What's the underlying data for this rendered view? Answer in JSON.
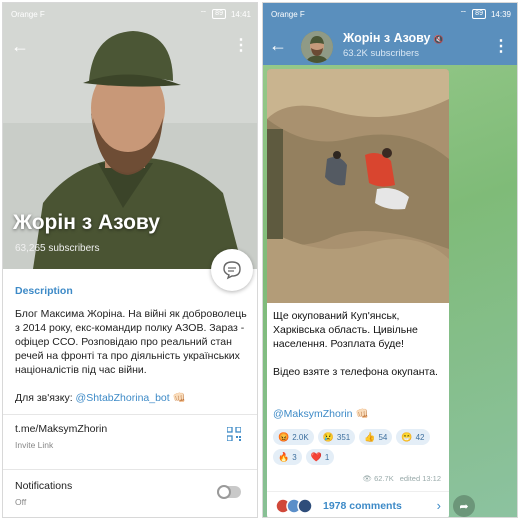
{
  "left_status": {
    "carrier": "Orange F",
    "time": "14:41",
    "battery": "89"
  },
  "right_status": {
    "carrier": "Orange F",
    "time": "14:39",
    "battery": "89"
  },
  "profile": {
    "title": "Жорін з Азову",
    "subscribers": "63,265 subscribers",
    "description_heading": "Description",
    "description": "Блог Максима Жоріна. На війні як доброволець з 2014 року, екс-командир полку АЗОВ. Зараз - офіцер ССО. Розповідаю про реальний стан речей на фронті та про діяльність українських націоналістів під час війни.",
    "contact_label": "Для зв'язку:",
    "contact_handle": "@ShtabZhorina_bot",
    "contact_emoji": "👊🏻",
    "invite_link": "t.me/MaksymZhorin",
    "invite_label": "Invite Link",
    "notifications_label": "Notifications",
    "notifications_state": "Off"
  },
  "channel": {
    "title": "Жорін з Азову",
    "subscribers": "63.2K subscribers",
    "post_paragraph_1": "Ще окупований Куп'янськ, Харківська область. Цивільне населення. Розплата буде!",
    "post_paragraph_2": "Відео взяте з телефона окупанта.",
    "mention": "@MaksymZhorin",
    "mention_emoji": "👊🏻",
    "reactions": [
      {
        "emoji": "😡",
        "count": "2.0K"
      },
      {
        "emoji": "😢",
        "count": "351"
      },
      {
        "emoji": "👍",
        "count": "54"
      },
      {
        "emoji": "😁",
        "count": "42"
      },
      {
        "emoji": "🔥",
        "count": "3"
      },
      {
        "emoji": "❤️",
        "count": "1"
      }
    ],
    "views": "62.7K",
    "edited": "edited 13:12",
    "comments_label": "1978 comments"
  },
  "colors": {
    "accent": "#3d8ac7",
    "header": "#5a8fbd",
    "reaction_bg": "#e4eef7"
  }
}
